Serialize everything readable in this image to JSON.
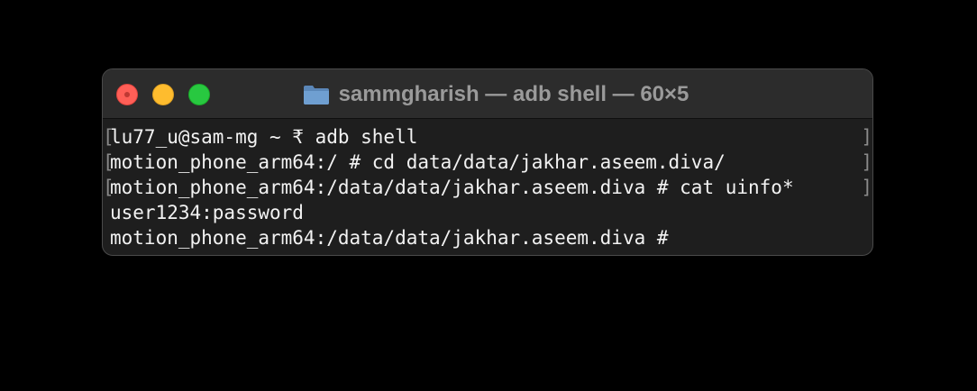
{
  "window": {
    "title": "sammgharish — adb shell — 60×5",
    "folder_icon": "folder-icon",
    "controls": [
      "close-button",
      "minimize-button",
      "zoom-button"
    ]
  },
  "terminal": {
    "lines": [
      {
        "text": "lu77_u@sam-mg ~ ₹ adb shell",
        "marked": true
      },
      {
        "text": "motion_phone_arm64:/ # cd data/data/jakhar.aseem.diva/",
        "marked": true
      },
      {
        "text": "motion_phone_arm64:/data/data/jakhar.aseem.diva # cat uinfo*",
        "marked": true
      },
      {
        "text": "user1234:password",
        "marked": false
      },
      {
        "text": "motion_phone_arm64:/data/data/jakhar.aseem.diva # ",
        "marked": false
      }
    ],
    "bracket_left": "[",
    "bracket_right": "]"
  },
  "colors": {
    "background": "#000000",
    "window_bg": "#1e1e1e",
    "titlebar_bg": "#2c2c2c",
    "close": "#ff5f57",
    "minimize": "#febc2e",
    "zoom": "#28c840",
    "folder": "#6f9fd1"
  }
}
